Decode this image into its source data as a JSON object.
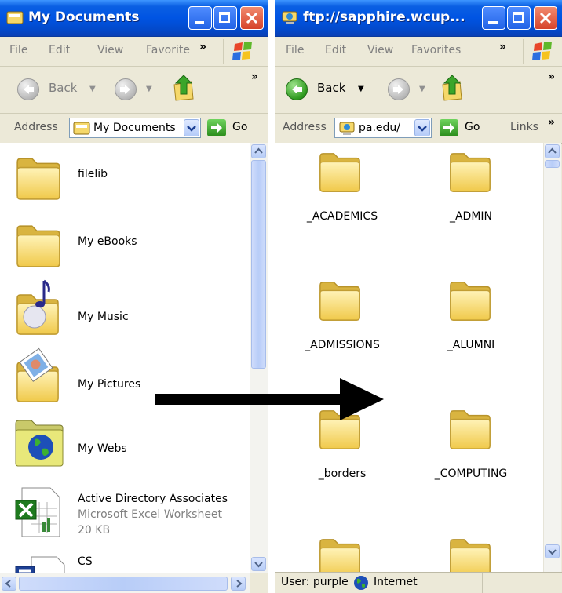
{
  "left_window": {
    "title": "My Documents",
    "menu": [
      "File",
      "Edit",
      "View",
      "Favorite"
    ],
    "back_label": "Back",
    "address_label": "Address",
    "address_value": "My Documents",
    "go_label": "Go",
    "items": [
      {
        "name": "filelib",
        "icon": "folder-icon"
      },
      {
        "name": "My eBooks",
        "icon": "folder-icon"
      },
      {
        "name": "My Music",
        "icon": "music-folder-icon"
      },
      {
        "name": "My Pictures",
        "icon": "pictures-folder-icon"
      },
      {
        "name": "My Webs",
        "icon": "web-folder-icon"
      },
      {
        "name": "Active Directory Associates",
        "type": "Microsoft Excel Worksheet",
        "size": "20 KB",
        "icon": "excel-file-icon"
      },
      {
        "name": "CS",
        "icon": "file-icon"
      }
    ]
  },
  "right_window": {
    "title": "ftp://sapphire.wcup...",
    "menu": [
      "File",
      "Edit",
      "View",
      "Favorites"
    ],
    "back_label": "Back",
    "address_label": "Address",
    "address_value": "pa.edu/",
    "go_label": "Go",
    "links_label": "Links",
    "items": [
      {
        "name": "_ACADEMICS"
      },
      {
        "name": "_ADMIN"
      },
      {
        "name": "_ADMISSIONS"
      },
      {
        "name": "_ALUMNI"
      },
      {
        "name": "_borders"
      },
      {
        "name": "_COMPUTING"
      },
      {
        "name": ""
      },
      {
        "name": ""
      }
    ],
    "status_user": "User: purple",
    "status_zone": "Internet"
  },
  "colors": {
    "titlebar": "#0054e3",
    "chrome": "#ece9d8",
    "folder": "#f5d86a"
  }
}
